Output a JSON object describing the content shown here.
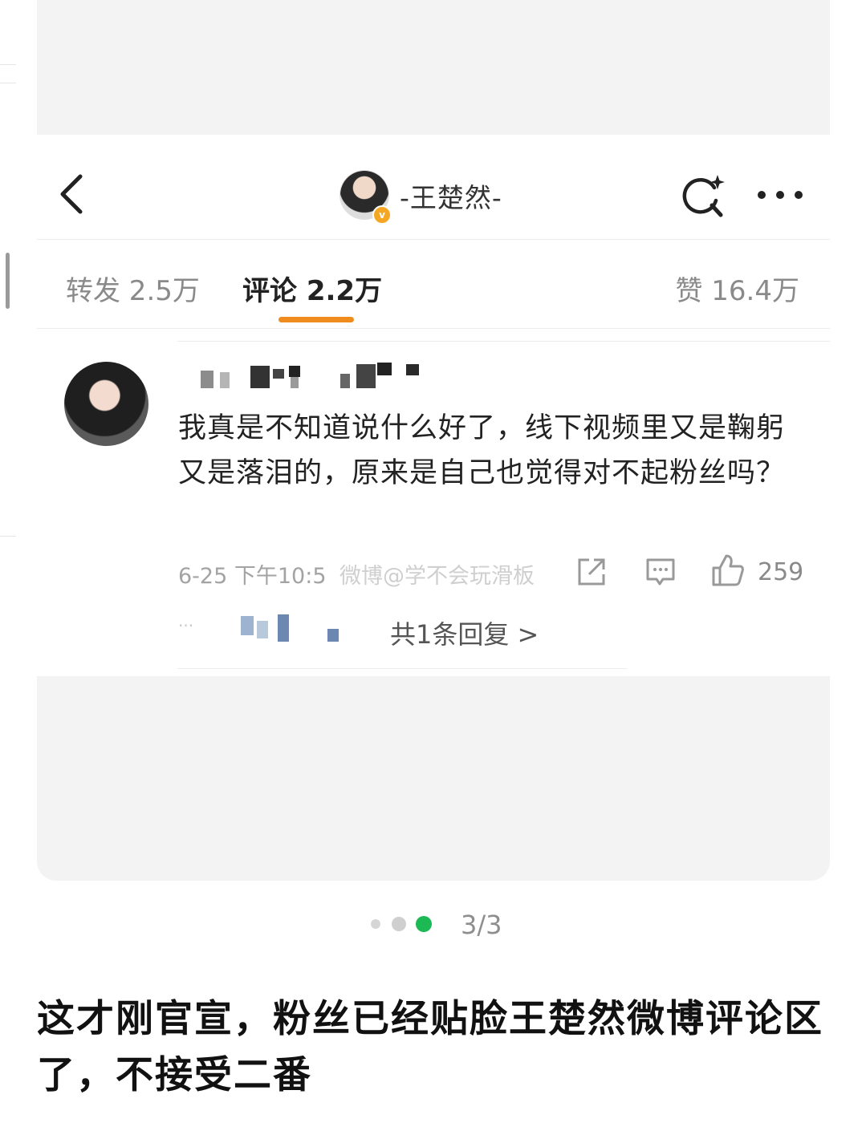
{
  "header": {
    "title": "-王楚然-",
    "verified_badge": "v"
  },
  "tabs": {
    "repost": "转发 2.5万",
    "comment": "评论 2.2万",
    "like": "赞 16.4万",
    "active": "comment",
    "accent_color": "#f08b1e"
  },
  "comment": {
    "text": "我真是不知道说什么好了，线下视频里又是鞠躬又是落泪的，原来是自己也觉得对不起粉丝吗？",
    "meta": "6-25 下午10:5",
    "watermark": "微博@学不会玩滑板",
    "like_count": "259",
    "reply_link": "共1条回复 >",
    "reply_dots": "···"
  },
  "pager": {
    "label": "3/3",
    "total": 3,
    "current": 3,
    "active_color": "#1db954"
  },
  "caption": "这才刚官宣，粉丝已经贴脸王楚然微博评论区了，不接受二番",
  "icons": [
    "back-icon",
    "search-sparkle-icon",
    "more-icon",
    "share-icon",
    "reply-icon",
    "thumbs-up-icon"
  ]
}
